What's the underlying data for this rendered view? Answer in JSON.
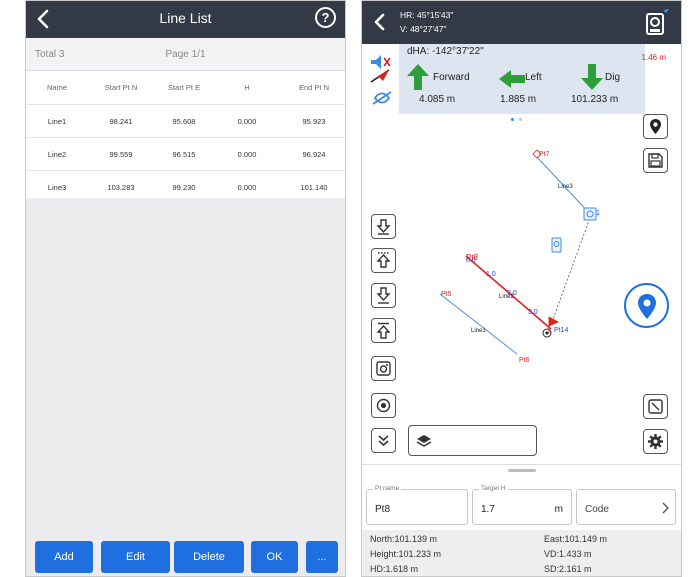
{
  "line_list": {
    "title": "Line List",
    "back_icon": "chevron-left-icon",
    "help_icon": "question-circle-icon",
    "total": "Total 3",
    "page": "Page 1/1",
    "columns": [
      "Name",
      "Start Pt N",
      "Start Pt E",
      "H",
      "End Pt N"
    ],
    "rows": [
      [
        "Line1",
        "98.241",
        "95.608",
        "0.000",
        "95.923"
      ],
      [
        "Line2",
        "99.559",
        "96.515",
        "0.000",
        "96.924"
      ],
      [
        "Line3",
        "103.283",
        "99.230",
        "0.000",
        "101.140"
      ]
    ],
    "buttons": {
      "add": "Add",
      "edit": "Edit",
      "delete": "Delete",
      "ok": "OK",
      "more": "..."
    },
    "accent_color": "#1f6fe0",
    "topbar_color": "#333a46"
  },
  "stakeout": {
    "hr": "HR: 45°15'43\"",
    "v": "V: 48°27'47\"",
    "dha": "dHA: -142°37'22\"",
    "directions": [
      {
        "label": "Forward",
        "value": "4.085 m",
        "icon": "arrow-up-icon"
      },
      {
        "label": "Left",
        "value": "1.885 m",
        "icon": "arrow-left-icon"
      },
      {
        "label": "Dig",
        "value": "101.233 m",
        "icon": "arrow-down-icon"
      }
    ],
    "red_value": "1.46 m",
    "map": {
      "labels": {
        "pt7": "Pt7",
        "line3": "Line3",
        "pt8": "Pt8",
        "pt5": "Pt5",
        "pt6": "Pt6",
        "pt14": "Pt14",
        "line1": "Line1",
        "line2": "Line2",
        "tick_1": "1.0",
        "tick_2": "2.0",
        "tick_3": "3.0",
        "tick_0": "0.0",
        "tick_1b": "1"
      }
    },
    "fields": {
      "pt_name_label": "Pt name",
      "pt_name_value": "Pt8",
      "target_h_label": "Target H",
      "target_h_value": "1.7",
      "target_h_unit": "m",
      "code_placeholder": "Code"
    },
    "info": {
      "north": "North:101.139 m",
      "east": "East:101.149 m",
      "height": "Height:101.233 m",
      "vd": "VD:1.433 m",
      "hd": "HD:1.618 m",
      "sd": "SD:2.161 m"
    },
    "colors": {
      "forward_arrow": "#2e9e3b",
      "left_arrow": "#2e9e3b",
      "dig_arrow": "#2e9e3b",
      "point_red": "#e02020",
      "line_blue": "#4a90e2",
      "fab_blue": "#1f6fe0"
    }
  }
}
